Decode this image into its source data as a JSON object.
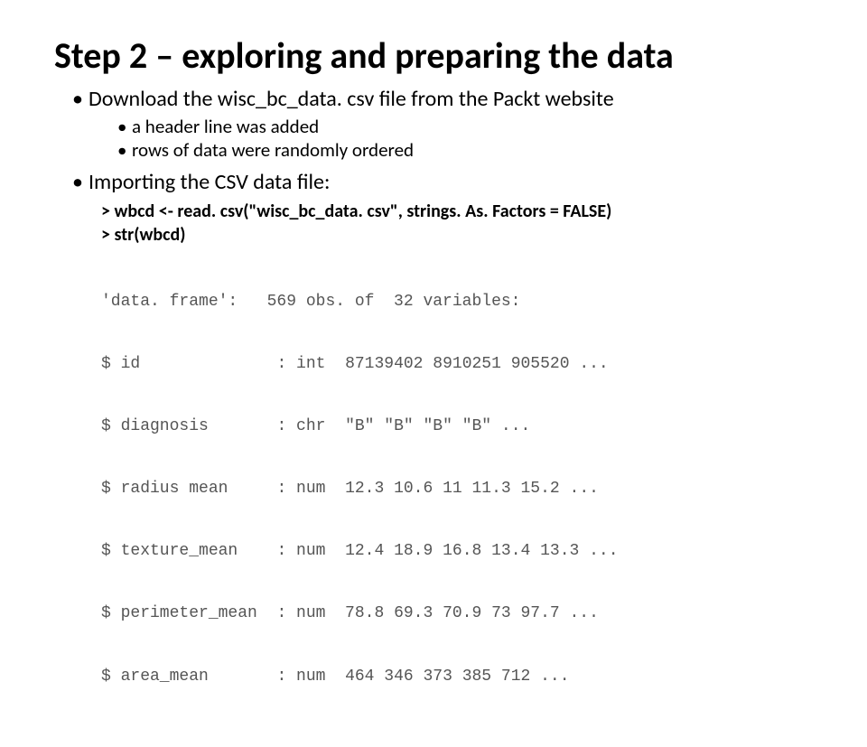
{
  "title": "Step 2 – exploring and preparing the data",
  "bullets": {
    "b1": "Download the wisc_bc_data. csv file from the Packt website",
    "b1a": "a header line was added",
    "b1b": "rows of data were randomly ordered",
    "b2": "Importing the CSV data file:"
  },
  "code": {
    "line1": "> wbcd <- read. csv(\"wisc_bc_data. csv\", strings. As. Factors = FALSE)",
    "line2": "> str(wbcd)"
  },
  "str_output": {
    "header": "'data. frame':   569 obs. of  32 variables:",
    "rows": [
      {
        "name": "$ id",
        "type": ": int",
        "vals": "  87139402 8910251 905520 ..."
      },
      {
        "name": "$ diagnosis",
        "type": ": chr",
        "vals": "  \"B\" \"B\" \"B\" \"B\" ..."
      },
      {
        "name": "$ radius mean",
        "type": ": num",
        "vals": "  12.3 10.6 11 11.3 15.2 ..."
      },
      {
        "name": "$ texture_mean",
        "type": ": num",
        "vals": "  12.4 18.9 16.8 13.4 13.3 ..."
      },
      {
        "name": "$ perimeter_mean",
        "type": ": num",
        "vals": "  78.8 69.3 70.9 73 97.7 ..."
      },
      {
        "name": "$ area_mean",
        "type": ": num",
        "vals": "  464 346 373 385 712 ..."
      }
    ]
  }
}
